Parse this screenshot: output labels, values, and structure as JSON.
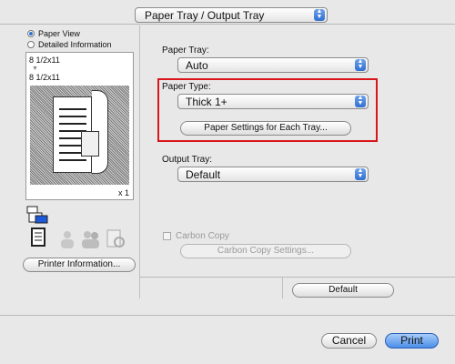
{
  "panel_select": {
    "value": "Paper Tray / Output Tray"
  },
  "view_options": {
    "paper_view": "Paper View",
    "detailed_information": "Detailed Information"
  },
  "preview": {
    "size_top": "8 1/2x11",
    "size_bottom": "8 1/2x11",
    "copies": "x 1"
  },
  "printer_info_button": "Printer Information...",
  "paper_tray": {
    "label": "Paper Tray:",
    "value": "Auto"
  },
  "paper_type": {
    "label": "Paper Type:",
    "value": "Thick 1+"
  },
  "paper_settings_button": "Paper Settings for Each Tray...",
  "output_tray": {
    "label": "Output Tray:",
    "value": "Default"
  },
  "carbon_copy": {
    "label": "Carbon Copy",
    "settings_button": "Carbon Copy Settings..."
  },
  "default_button": "Default",
  "cancel_button": "Cancel",
  "print_button": "Print",
  "colors": {
    "highlight": "#d9161c",
    "accent": "#2f6fd2"
  }
}
